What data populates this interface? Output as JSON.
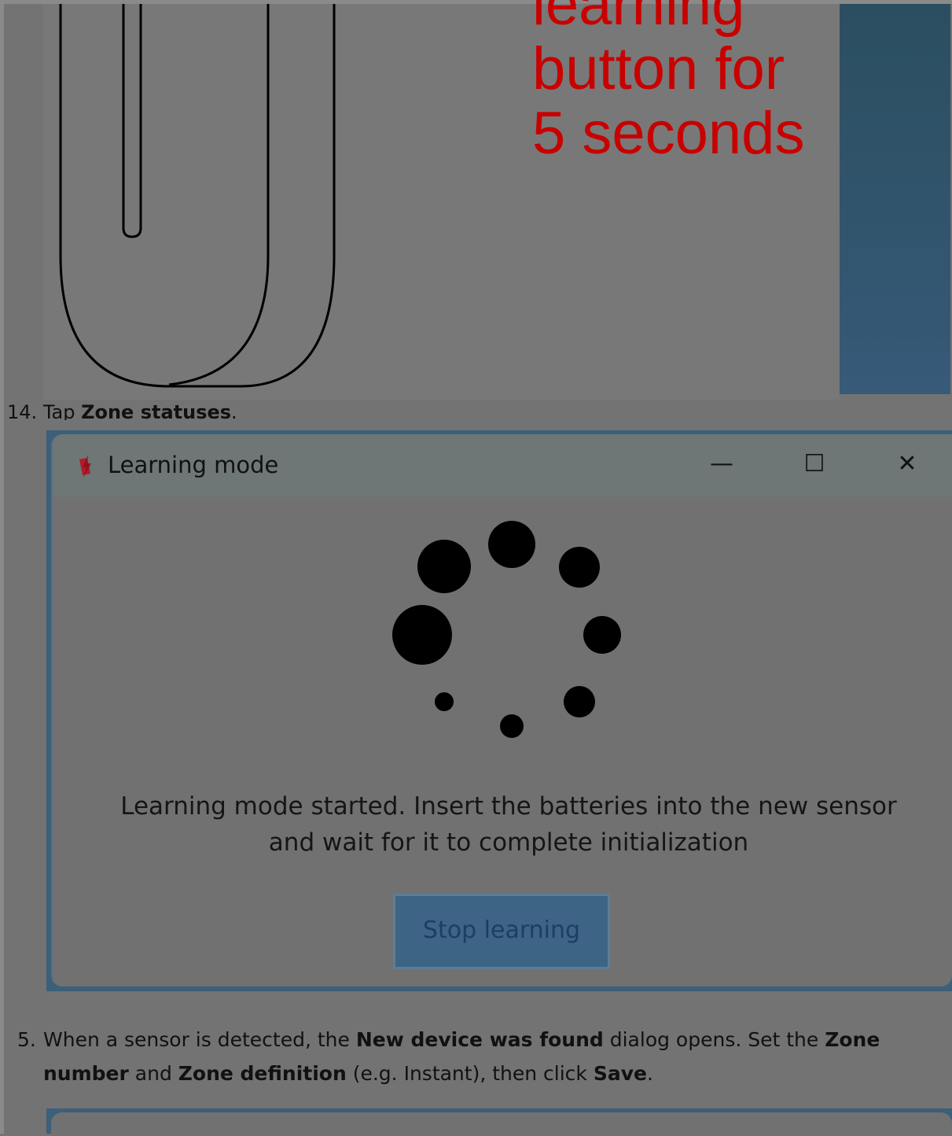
{
  "illustration": {
    "instruction_text": "learning\nbutton for\n5 seconds"
  },
  "steps": {
    "step14": {
      "number": "14.",
      "prefix": "Tap ",
      "bold": "Zone statuses",
      "suffix": "."
    },
    "step5": {
      "number": "5.",
      "t1": "When a sensor is detected, the ",
      "b1": "New device was found",
      "t2": " dialog opens. Set the ",
      "b2": "Zone number",
      "t3": " and ",
      "b3": "Zone definition",
      "t4": " (e.g. Instant), then click ",
      "b4": "Save",
      "t5": "."
    }
  },
  "dialog": {
    "title": "Learning mode",
    "minimize_glyph": "—",
    "maximize_glyph": "☐",
    "close_glyph": "✕",
    "message": "Learning mode started. Insert the batteries into the new sensor and wait for it to complete initialization",
    "stop_button_label": "Stop learning",
    "icons": {
      "app": "learning-mode-app-icon",
      "spinner": "loading-spinner-icon"
    }
  },
  "colors": {
    "overlay_gray": "#737373",
    "red_text": "#c80000",
    "blue_frame": "#3c5f7a",
    "button_blue": "#3d6484"
  }
}
